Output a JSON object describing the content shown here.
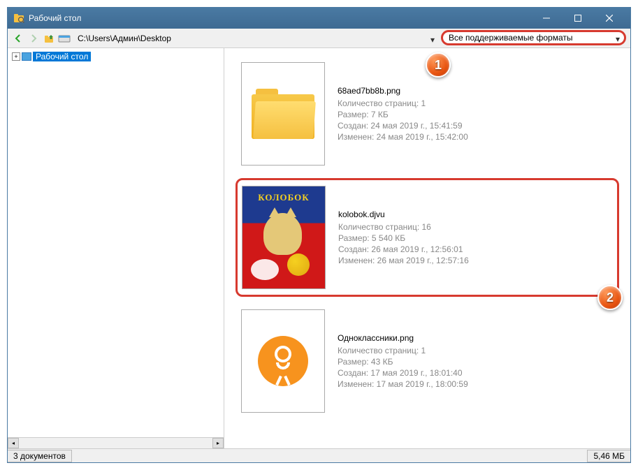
{
  "window": {
    "title": "Рабочий стол"
  },
  "toolbar": {
    "path": "C:\\Users\\Админ\\Desktop",
    "filter": "Все поддерживаемые форматы"
  },
  "tree": {
    "root_label": "Рабочий стол"
  },
  "badges": {
    "one": "1",
    "two": "2"
  },
  "items": [
    {
      "filename": "68aed7bb8b.png",
      "pages": "Количество страниц: 1",
      "size": "Размер: 7 КБ",
      "created": "Создан: 24 мая 2019 г., 15:41:59",
      "modified": "Изменен: 24 мая 2019 г., 15:42:00"
    },
    {
      "filename": "kolobok.djvu",
      "pages": "Количество страниц: 16",
      "size": "Размер: 5 540 КБ",
      "created": "Создан: 26 мая 2019 г., 12:56:01",
      "modified": "Изменен: 26 мая 2019 г., 12:57:16"
    },
    {
      "filename": "Одноклассники.png",
      "pages": "Количество страниц: 1",
      "size": "Размер: 43 КБ",
      "created": "Создан: 17 мая 2019 г., 18:01:40",
      "modified": "Изменен: 17 мая 2019 г., 18:00:59"
    }
  ],
  "kolobok_thumb_title": "КОЛОБОК",
  "status": {
    "docs": "3 документов",
    "size": "5,46 МБ"
  }
}
